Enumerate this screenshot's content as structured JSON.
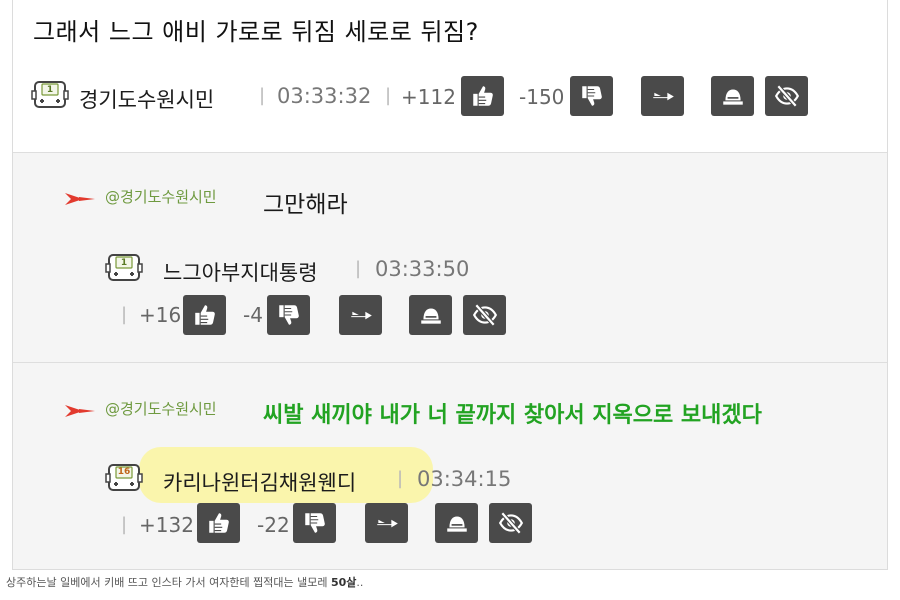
{
  "main": {
    "text": "그래서 느그 애비 가로로 뒤짐 세로로 뒤짐?",
    "nick": "경기도수원시민",
    "time": "03:33:32",
    "up": "+112",
    "down": "-150"
  },
  "replies": [
    {
      "mention": "@경기도수원시민",
      "text": "그만해라",
      "nick": "느그아부지대통령",
      "time": "03:33:50",
      "up": "+16",
      "down": "-4",
      "level_badge": "1"
    },
    {
      "mention": "@경기도수원시민",
      "text": "씨발 새끼야 내가 너 끝까지 찾아서 지옥으로 보내겠다",
      "nick": "카리나윈터김채원웬디",
      "time": "03:34:15",
      "up": "+132",
      "down": "-22",
      "level_badge": "16"
    }
  ],
  "main_level_badge": "1",
  "caption": {
    "text": "상주하는날 일베에서 키배 뜨고 인스타 가서 여자한테 찝적대는 낼모레 ",
    "emphasis": "50살",
    "tail": ".."
  },
  "icons": [
    "level-badge-icon",
    "thumbs-up-icon",
    "thumbs-down-icon",
    "reply-icon",
    "alarm-icon",
    "hide-icon",
    "reply-arrow-icon"
  ],
  "colors": {
    "button_bg": "#4a4a4a",
    "mention": "#6f9a40",
    "green_text": "#22a322",
    "reply_arrow": "#e23a2e",
    "highlight": "#fbf5a4",
    "reply_bg": "#f5f5f5"
  }
}
